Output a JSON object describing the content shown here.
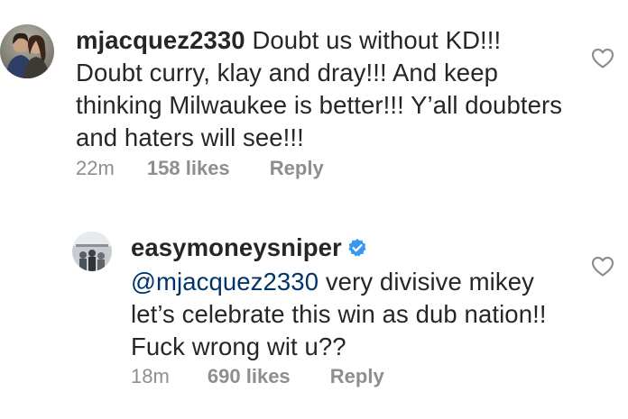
{
  "comments": [
    {
      "username": "mjacquez2330",
      "text": " Doubt us without KD!!! Doubt curry, klay and dray!!! And keep thinking Milwaukee is better!!! Y’all doubters and haters will see!!!",
      "time": "22m",
      "likes": "158 likes",
      "reply": "Reply"
    },
    {
      "username": "easymoneysniper",
      "verified": true,
      "mention": "@mjacquez2330",
      "text": " very divisive mikey let’s celebrate this win as dub nation!! Fuck wrong wit u??",
      "time": "18m",
      "likes": "690 likes",
      "reply": "Reply"
    }
  ],
  "colors": {
    "text": "#262626",
    "meta": "#8e8e8e",
    "mention": "#003569",
    "verified": "#3897f0",
    "heart_outline": "#8e8e8e"
  }
}
